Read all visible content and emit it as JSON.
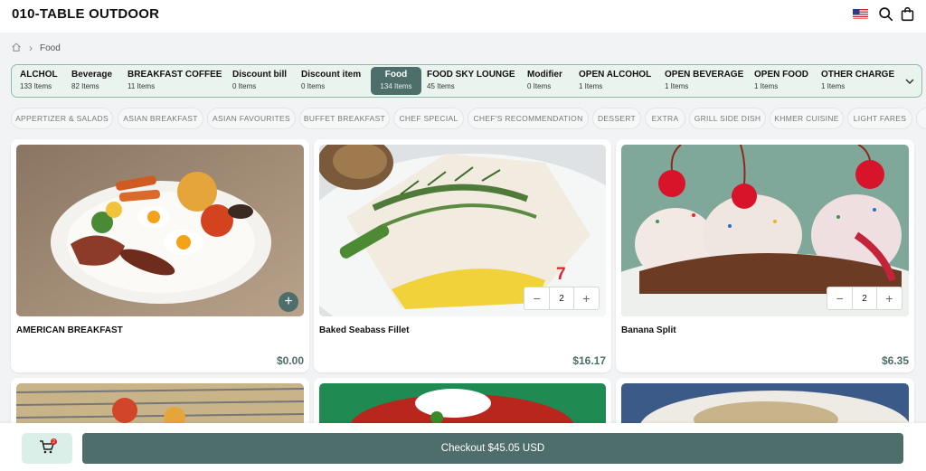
{
  "header": {
    "title": "010-TABLE OUTDOOR",
    "icons": [
      "us-flag-icon",
      "search-icon",
      "shopping-bag-icon"
    ]
  },
  "breadcrumb": {
    "current": "Food"
  },
  "categories": [
    {
      "name": "ALCHOL",
      "count": "133 Items"
    },
    {
      "name": "Beverage",
      "count": "82 Items"
    },
    {
      "name": "BREAKFAST COFFEE",
      "count": "11 Items"
    },
    {
      "name": "Discount bill",
      "count": "0 Items"
    },
    {
      "name": "Discount item",
      "count": "0 Items"
    },
    {
      "name": "Food",
      "count": "134 Items",
      "active": true
    },
    {
      "name": "FOOD SKY LOUNGE",
      "count": "45 Items"
    },
    {
      "name": "Modifier",
      "count": "0 Items"
    },
    {
      "name": "OPEN ALCOHOL",
      "count": "1 Items"
    },
    {
      "name": "OPEN BEVERAGE",
      "count": "1 Items"
    },
    {
      "name": "OPEN FOOD",
      "count": "1 Items"
    },
    {
      "name": "OTHER CHARGE",
      "count": "1 Items"
    }
  ],
  "subcategories": [
    "APPERTIZER & SALADS",
    "ASIAN BREAKFAST",
    "ASIAN FAVOURITES",
    "BUFFET BREAKFAST",
    "CHEF SPECIAL",
    "CHEF'S RECOMMENDATION",
    "DESSERT",
    "EXTRA",
    "GRILL SIDE DISH",
    "KHMER CUISINE",
    "LIGHT FARES"
  ],
  "products": [
    {
      "name": "AMERICAN BREAKFAST",
      "price": "$0.00"
    },
    {
      "name": "Baked Seabass Fillet",
      "price": "$16.17",
      "quantity": "2",
      "marker": "7"
    },
    {
      "name": "Banana Split",
      "price": "$6.35",
      "quantity": "2"
    }
  ],
  "cart": {
    "badge": "2"
  },
  "checkout": {
    "label": "Checkout $45.05 USD"
  },
  "colors": {
    "accent": "#4d6e6a",
    "category_bg": "#e9f4ef",
    "marker": "#e0242a"
  }
}
